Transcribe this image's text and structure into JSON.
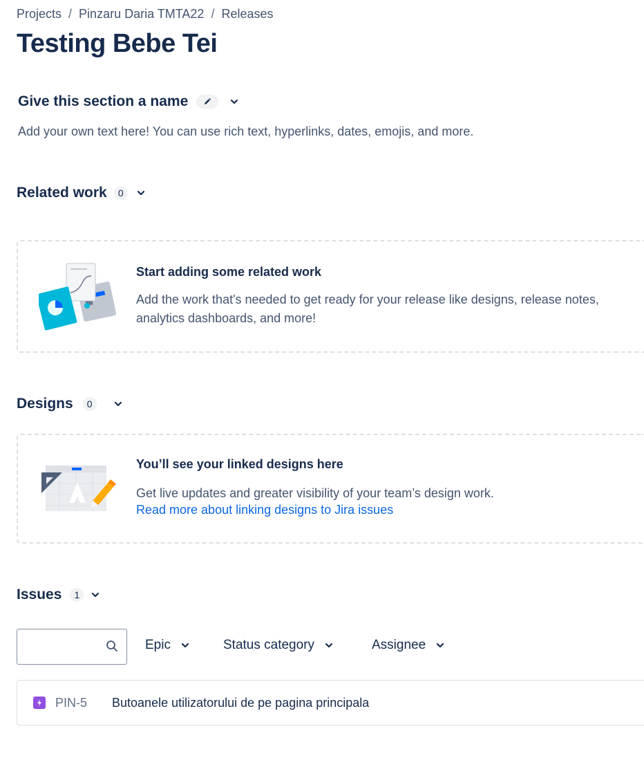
{
  "breadcrumbs": [
    "Projects",
    "Pinzaru Daria TMTA22",
    "Releases"
  ],
  "breadcrumb_separator": "/",
  "page_title": "Testing Bebe Tei",
  "custom_section": {
    "title": "Give this section a name",
    "description": "Add your own text here! You can use rich text, hyperlinks, dates, emojis, and more.",
    "edit_icon": "pencil-icon",
    "toggle_icon": "chevron-down-icon"
  },
  "related_work": {
    "heading": "Related work",
    "count": "0",
    "empty_title": "Start adding some related work",
    "empty_text": "Add the work that's needed to get ready for your release like designs, release notes, analytics dashboards, and more!"
  },
  "designs": {
    "heading": "Designs",
    "count": "0",
    "empty_title": "You’ll see your linked designs here",
    "empty_text": "Get live updates and greater visibility of your team’s design work.",
    "link_text": "Read more about linking designs to Jira issues"
  },
  "issues": {
    "heading": "Issues",
    "count": "1",
    "search_placeholder": "",
    "search_icon": "search-icon",
    "filters": [
      "Epic",
      "Status category",
      "Assignee"
    ],
    "rows": [
      {
        "key": "PIN-5",
        "summary": "Butoanele utilizatorului de pe pagina principala",
        "type_icon": "epic-icon"
      }
    ]
  },
  "colors": {
    "text": "#172B4D",
    "subtle_text": "#44546F",
    "link": "#0C66E4",
    "epic": "#904EE2",
    "dashed_border": "#DCDFE4"
  }
}
